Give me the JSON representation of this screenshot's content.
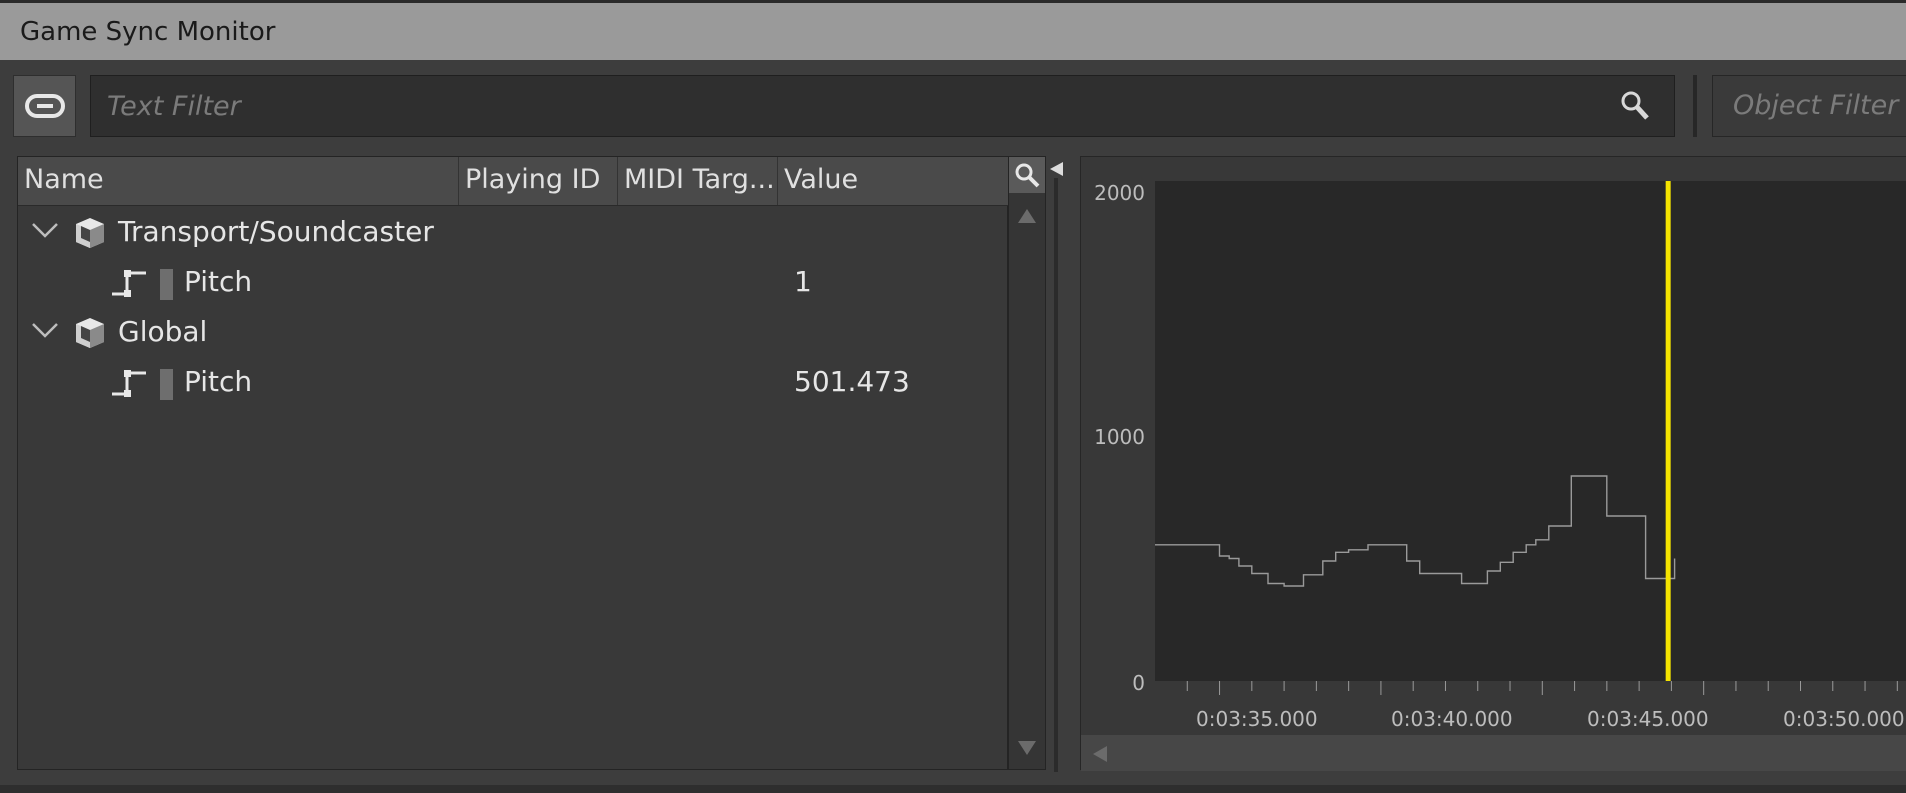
{
  "window": {
    "title": "Game Sync Monitor"
  },
  "toolbar": {
    "text_filter_placeholder": "Text Filter",
    "object_filter_placeholder": "Object Filter"
  },
  "table": {
    "columns": [
      "Name",
      "Playing ID",
      "MIDI Targ...",
      "Value"
    ],
    "rows": [
      {
        "name": "Transport/Soundcaster",
        "value": ""
      },
      {
        "name": "Pitch",
        "value": "1"
      },
      {
        "name": "Global",
        "value": ""
      },
      {
        "name": "Pitch",
        "value": "501.473"
      }
    ]
  },
  "graph": {
    "y_ticks": [
      "2000",
      "1000",
      "0"
    ],
    "x_ticks": [
      "0:03:35.000",
      "0:03:40.000",
      "0:03:45.000",
      "0:03:50.000"
    ],
    "line_color": "#9a9a9a",
    "cursor_color": "#f5e400"
  },
  "chart_data": {
    "type": "line",
    "title": "",
    "xlabel": "",
    "ylabel": "",
    "ylim": [
      0,
      2000
    ],
    "x_unit": "seconds",
    "x_ticks": [
      215,
      220,
      225,
      230
    ],
    "series": [
      {
        "x": [
          213.0,
          214.8,
          215.0,
          215.3,
          215.6,
          216.0,
          216.5,
          217.0,
          217.3,
          217.6,
          217.9,
          218.2,
          218.6,
          219.0,
          219.6,
          219.9,
          220.3,
          220.8,
          221.2,
          222.5,
          222.9,
          223.3,
          223.7,
          224.1,
          224.5,
          224.8,
          225.2,
          225.5,
          225.9,
          226.0,
          227.0,
          227.2,
          227.9,
          228.2,
          228.9,
          229.1
        ],
        "y": [
          545,
          545,
          500,
          490,
          460,
          430,
          390,
          380,
          380,
          425,
          425,
          480,
          515,
          525,
          545,
          545,
          545,
          480,
          430,
          390,
          390,
          440,
          475,
          515,
          545,
          565,
          620,
          620,
          820,
          820,
          660,
          660,
          660,
          410,
          410,
          490
        ]
      }
    ],
    "cursor_x": 228.9
  }
}
